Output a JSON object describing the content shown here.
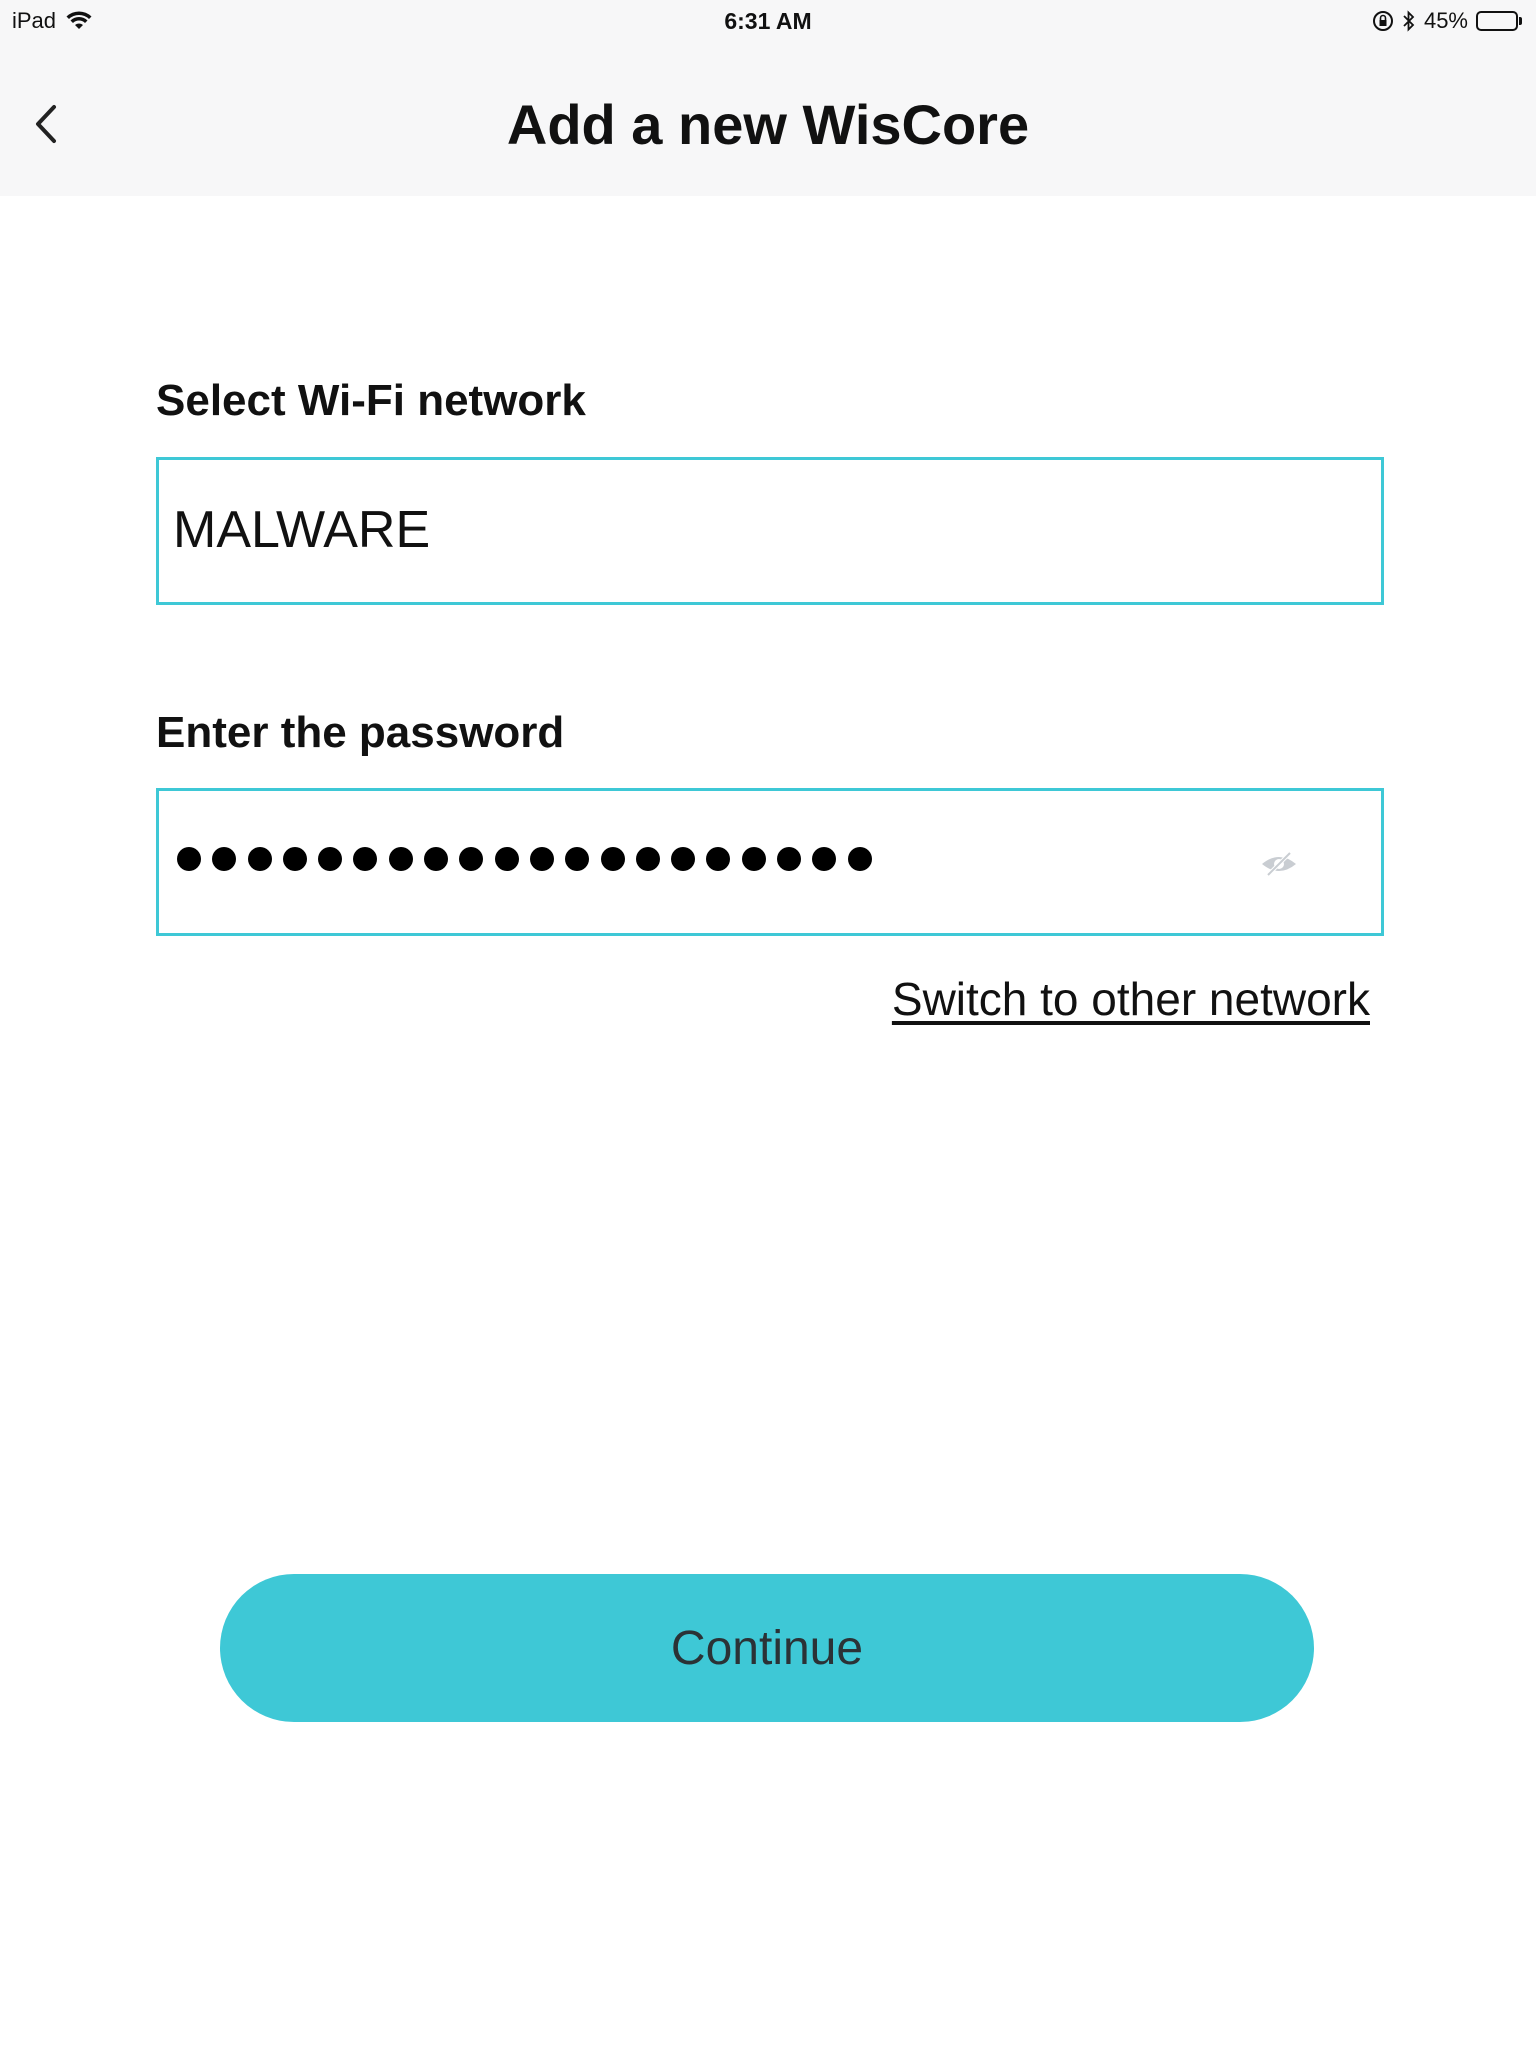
{
  "status_bar": {
    "device": "iPad",
    "time": "6:31 AM",
    "battery_text": "45%",
    "battery_level": 0.45
  },
  "nav": {
    "title": "Add a new WisCore"
  },
  "form": {
    "network_label": "Select Wi-Fi network",
    "network_value": "MALWARE",
    "password_label": "Enter the password",
    "password_masked_length": 20,
    "switch_link": "Switch to other network",
    "continue_label": "Continue"
  },
  "colors": {
    "accent": "#3ec8d6",
    "nav_background": "#f7f7f8"
  }
}
